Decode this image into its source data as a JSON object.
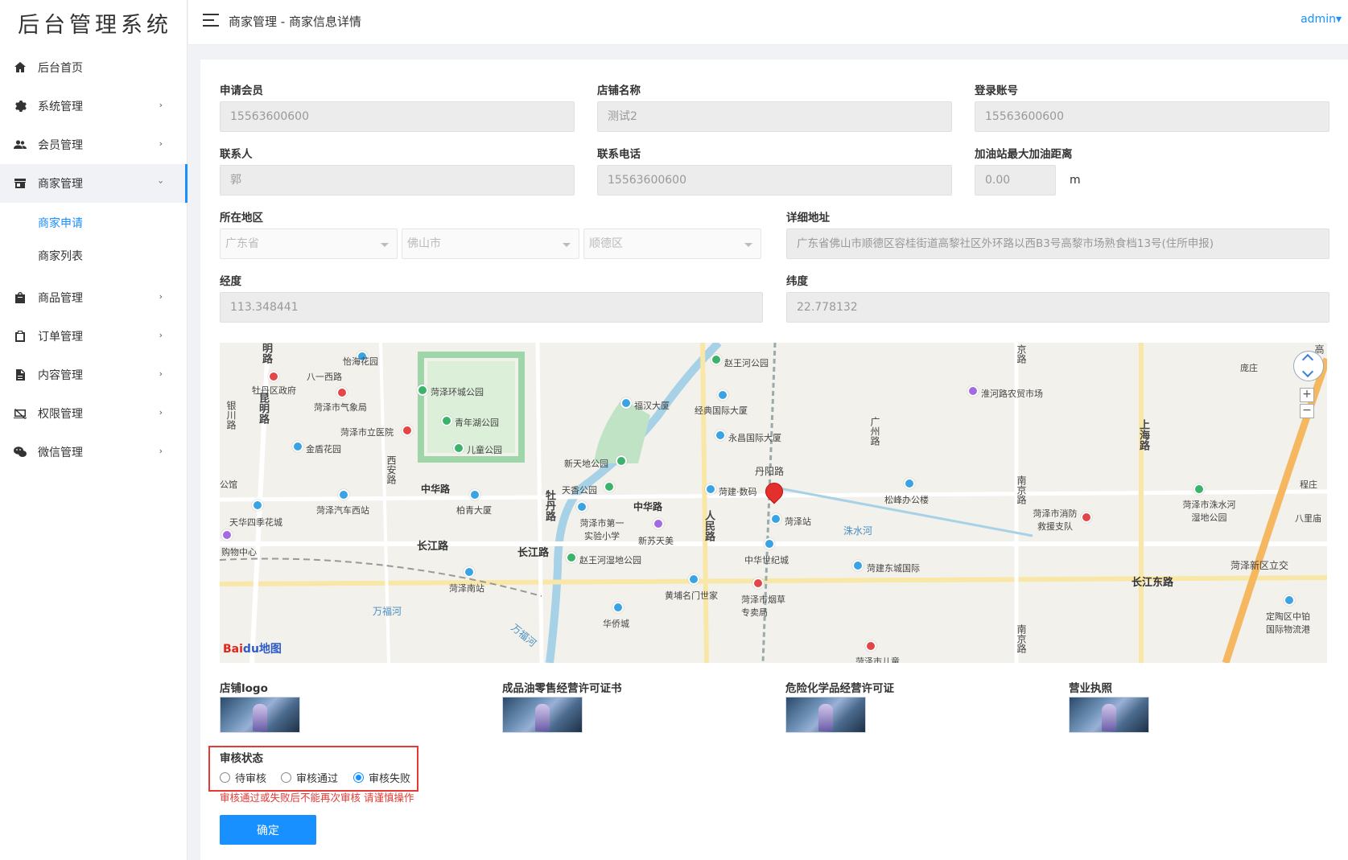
{
  "app": {
    "title": "后台管理系统"
  },
  "header": {
    "breadcrumb": "商家管理 - 商家信息详情",
    "user": "admin"
  },
  "sidebar": {
    "items": [
      {
        "label": "后台首页",
        "icon": "home-icon"
      },
      {
        "label": "系统管理",
        "icon": "gear-icon"
      },
      {
        "label": "会员管理",
        "icon": "users-icon"
      },
      {
        "label": "商家管理",
        "icon": "store-icon",
        "open": true,
        "children": [
          {
            "label": "商家申请",
            "active": true
          },
          {
            "label": "商家列表"
          }
        ]
      },
      {
        "label": "商品管理",
        "icon": "bag-icon"
      },
      {
        "label": "订单管理",
        "icon": "clipboard-icon"
      },
      {
        "label": "内容管理",
        "icon": "document-icon"
      },
      {
        "label": "权限管理",
        "icon": "key-icon"
      },
      {
        "label": "微信管理",
        "icon": "wechat-icon"
      }
    ]
  },
  "form": {
    "applicant": {
      "label": "申请会员",
      "value": "15563600600"
    },
    "store_name": {
      "label": "店铺名称",
      "value": "测试2"
    },
    "login_account": {
      "label": "登录账号",
      "value": "15563600600"
    },
    "contact": {
      "label": "联系人",
      "value": "郭"
    },
    "phone": {
      "label": "联系电话",
      "value": "15563600600"
    },
    "max_distance": {
      "label": "加油站最大加油距离",
      "value": "0.00",
      "unit": "m"
    },
    "region": {
      "label": "所在地区",
      "province": "广东省",
      "city": "佛山市",
      "district": "顺德区"
    },
    "address": {
      "label": "详细地址",
      "value": "广东省佛山市顺德区容桂街道高黎社区外环路以西B3号高黎市场熟食档13号(住所申报)"
    },
    "longitude": {
      "label": "经度",
      "value": "113.348441"
    },
    "latitude": {
      "label": "纬度",
      "value": "22.778132"
    }
  },
  "map": {
    "logo": "Bai",
    "logo_tail": "du地图",
    "labels": {
      "l1": "怡海花园",
      "l2": "八一西路",
      "l3": "牡丹区政府",
      "l4": "菏泽市气象局",
      "l5": "菏泽环城公园",
      "l6": "青年湖公园",
      "l7": "菏泽市立医院",
      "l8": "金盾花园",
      "l9": "儿童公园",
      "l10": "福汉大厦",
      "l11": "经典国际大厦",
      "l12": "赵王河公园",
      "l13": "永昌国际大厦",
      "l14": "丹阳路",
      "l15": "新天地公园",
      "l16": "天香公园",
      "l17": "菏建·数码",
      "l18": "中华路",
      "l19": "菏泽汽车西站",
      "l20": "柏青大厦",
      "l21": "天华四季花城",
      "l22": "购物中心",
      "l23": "长江路",
      "l24": "长江路",
      "l25": "菏泽市第一实验小学",
      "l26": "新苏天美",
      "l27": "菏泽站",
      "l28": "洙水河",
      "l29": "中华世纪城",
      "l30": "赵王河湿地公园",
      "l31": "菏泽南站",
      "l32": "黄埔名门世家",
      "l33": "菏泽市烟草专卖局",
      "l34": "万福河",
      "l35": "华侨城",
      "l36": "菏建东城国际",
      "l37": "淮河路农贸市场",
      "l38": "松峰办公楼",
      "l39": "菏泽市消防救援支队",
      "l40": "菏泽市洙水河湿地公园",
      "l41": "菏泽新区立交",
      "l42": "长江东路",
      "l43": "定陶区中铂国际物流港",
      "l44": "庞庄",
      "l45": "八里庙",
      "l46": "程庄",
      "l47": "公馆",
      "l48": "菏泽市儿童",
      "v1": "昆明路",
      "v2": "银川路",
      "v3": "西安路",
      "v4": "牡丹路",
      "v5": "人民路",
      "v6": "广州路",
      "v7": "南京路",
      "v8": "上海路",
      "v9": "南京路",
      "v10": "京路",
      "v11": "明路",
      "v12": "高"
    }
  },
  "images": [
    {
      "label": "店铺logo"
    },
    {
      "label": "成品油零售经营许可证书"
    },
    {
      "label": "危险化学品经营许可证"
    },
    {
      "label": "营业执照"
    }
  ],
  "audit": {
    "label": "审核状态",
    "options": [
      {
        "label": "待审核"
      },
      {
        "label": "审核通过"
      },
      {
        "label": "审核失败",
        "checked": true
      }
    ],
    "warning": "审核通过或失败后不能再次审核 请谨慎操作"
  },
  "submit": {
    "label": "确定"
  },
  "colors": {
    "accent": "#1890ff",
    "warning": "#e53935",
    "input_bg": "#ececec"
  }
}
